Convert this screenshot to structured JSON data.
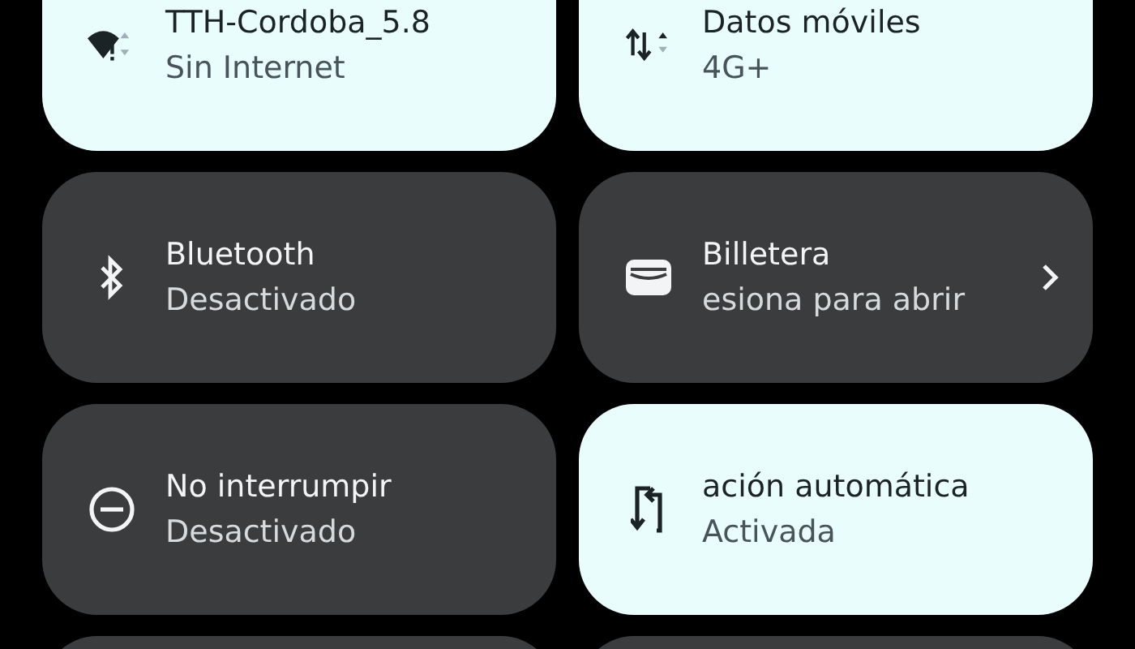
{
  "tiles": [
    {
      "kind": "wifi",
      "on": true,
      "title": "TTH-Cordoba_5.8",
      "subtitle": "Sin Internet",
      "chevron": false
    },
    {
      "kind": "mobile",
      "on": true,
      "title": "Datos móviles",
      "subtitle": "4G+",
      "chevron": false
    },
    {
      "kind": "bluetooth",
      "on": false,
      "title": "Bluetooth",
      "subtitle": "Desactivado",
      "chevron": false
    },
    {
      "kind": "wallet",
      "on": false,
      "title": "Billetera",
      "subtitle": "esiona para abrir",
      "chevron": true
    },
    {
      "kind": "dnd",
      "on": false,
      "title": "No interrumpir",
      "subtitle": "Desactivado",
      "chevron": false
    },
    {
      "kind": "rotate",
      "on": true,
      "title": "ación automática",
      "subtitle": "Activada",
      "chevron": false
    },
    {
      "kind": "blank",
      "on": false
    },
    {
      "kind": "blank",
      "on": false
    }
  ]
}
